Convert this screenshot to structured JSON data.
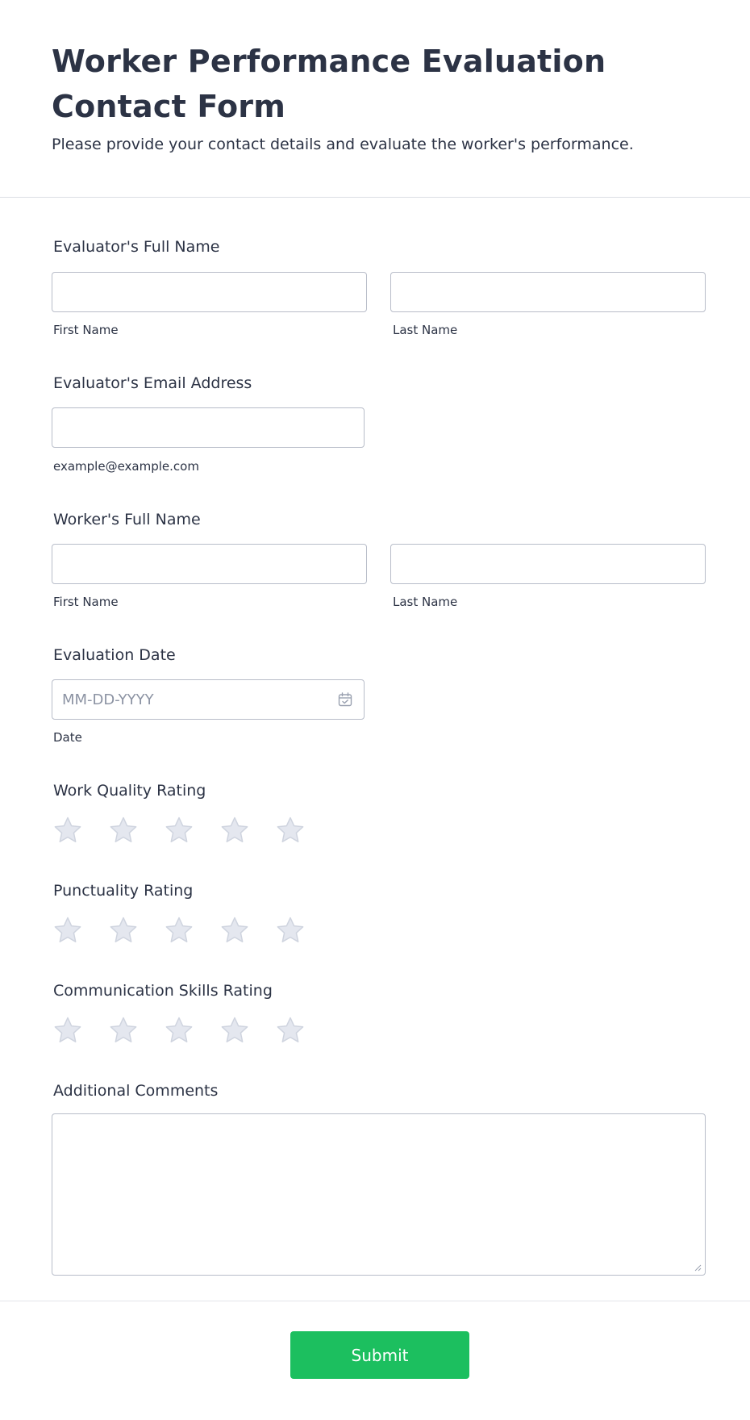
{
  "header": {
    "title": "Worker Performance Evaluation Contact Form",
    "subtitle": "Please provide your contact details and evaluate the worker's performance."
  },
  "evaluator_name": {
    "label": "Evaluator's Full Name",
    "first_value": "",
    "last_value": "",
    "first_sublabel": "First Name",
    "last_sublabel": "Last Name"
  },
  "evaluator_email": {
    "label": "Evaluator's Email Address",
    "value": "",
    "sublabel": "example@example.com"
  },
  "worker_name": {
    "label": "Worker's Full Name",
    "first_value": "",
    "last_value": "",
    "first_sublabel": "First Name",
    "last_sublabel": "Last Name"
  },
  "evaluation_date": {
    "label": "Evaluation Date",
    "placeholder": "MM-DD-YYYY",
    "value": "",
    "sublabel": "Date",
    "icon": "calendar-icon"
  },
  "ratings": [
    {
      "label": "Work Quality Rating",
      "value": 0,
      "max": 5
    },
    {
      "label": "Punctuality Rating",
      "value": 0,
      "max": 5
    },
    {
      "label": "Communication Skills Rating",
      "value": 0,
      "max": 5
    }
  ],
  "comments": {
    "label": "Additional Comments",
    "value": ""
  },
  "submit_label": "Submit",
  "colors": {
    "text": "#2c3345",
    "border": "#b8bdc9",
    "star_fill": "#e4e7ef",
    "star_stroke": "#cfd4df",
    "submit_bg": "#1cbf5f",
    "submit_text": "#ffffff"
  }
}
